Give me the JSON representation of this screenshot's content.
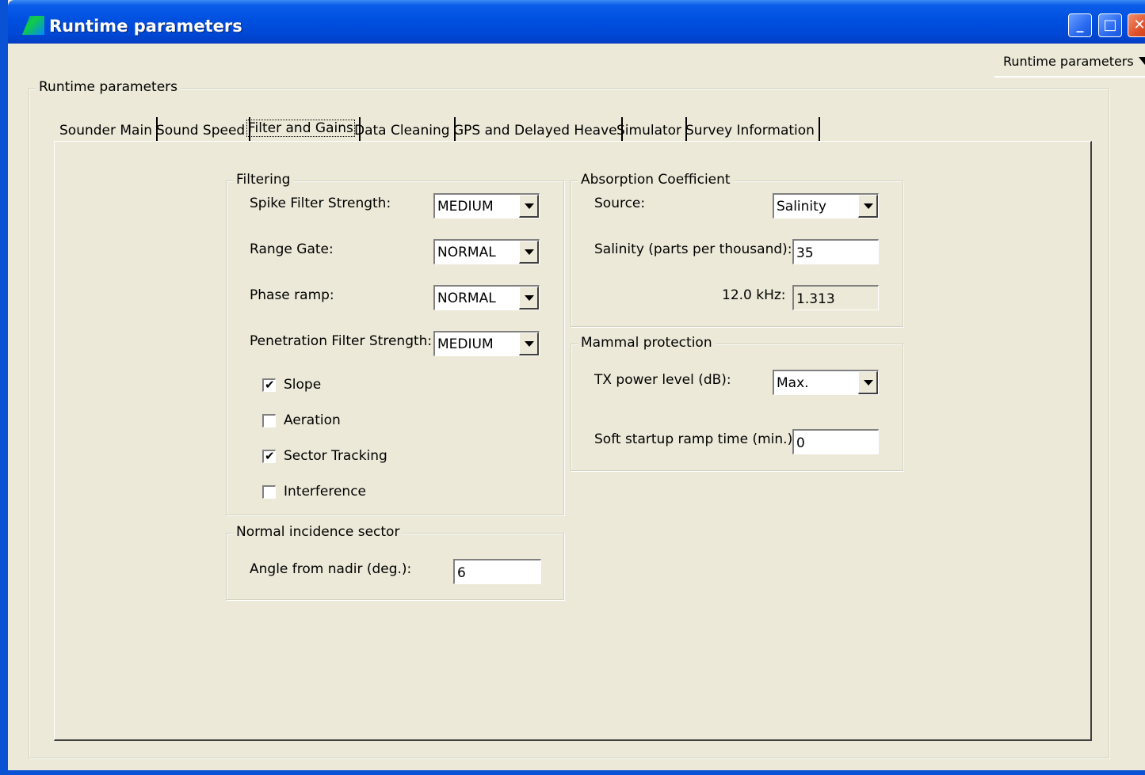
{
  "window": {
    "title": "Runtime parameters",
    "controls": {
      "minimize": "_",
      "maximize": "□",
      "close": "✕"
    },
    "view_selector": "Runtime parameters"
  },
  "outer_group": {
    "legend": "Runtime parameters"
  },
  "tabs": [
    {
      "label": "Sounder Main"
    },
    {
      "label": "Sound Speed"
    },
    {
      "label": "Filter and Gains"
    },
    {
      "label": "Data Cleaning"
    },
    {
      "label": "GPS and Delayed Heave"
    },
    {
      "label": "Simulator"
    },
    {
      "label": "Survey Information"
    }
  ],
  "filtering": {
    "legend": "Filtering",
    "spike": {
      "label": "Spike Filter Strength:",
      "value": "MEDIUM"
    },
    "range_gate": {
      "label": "Range Gate:",
      "value": "NORMAL"
    },
    "phase_ramp": {
      "label": "Phase ramp:",
      "value": "NORMAL"
    },
    "penetration": {
      "label": "Penetration Filter Strength:",
      "value": "MEDIUM"
    },
    "checks": [
      {
        "label": "Slope",
        "checked": true
      },
      {
        "label": "Aeration",
        "checked": false
      },
      {
        "label": "Sector Tracking",
        "checked": true
      },
      {
        "label": "Interference",
        "checked": false
      }
    ]
  },
  "normal_incidence": {
    "legend": "Normal incidence sector",
    "angle": {
      "label": "Angle from nadir (deg.):",
      "value": "6"
    }
  },
  "absorption": {
    "legend": "Absorption Coefficient",
    "source": {
      "label": "Source:",
      "value": "Salinity"
    },
    "salinity": {
      "label": "Salinity (parts per thousand):",
      "value": "35"
    },
    "freq": {
      "label": "12.0 kHz:",
      "value": "1.313"
    }
  },
  "mammal": {
    "legend": "Mammal protection",
    "tx_power": {
      "label": "TX power level (dB):",
      "value": "Max."
    },
    "soft_startup": {
      "label": "Soft startup ramp time (min.):",
      "value": "0"
    }
  }
}
